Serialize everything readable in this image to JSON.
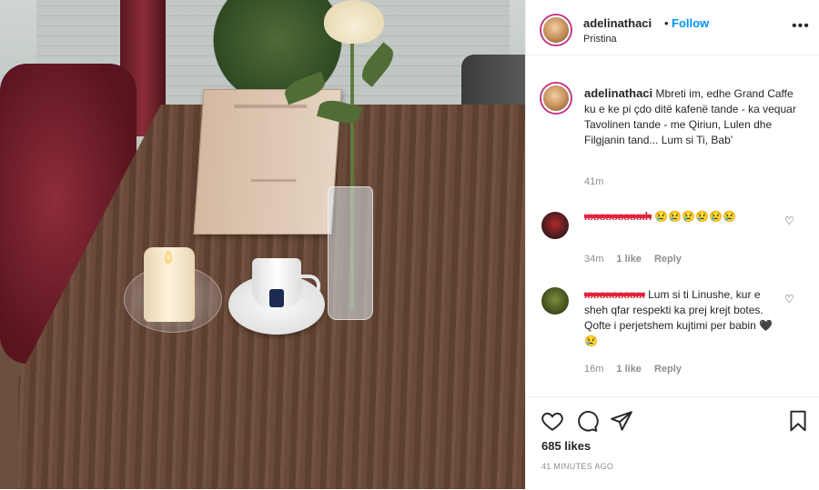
{
  "post": {
    "username": "adelinathaci",
    "follow_label": "Follow",
    "separator": "•",
    "location": "Pristina",
    "more_icon": "more-horizontal-icon"
  },
  "caption": {
    "username": "adelinathaci",
    "text": "Mbreti im, edhe Grand Caffe ku e ke pi çdo ditë kafenë tande - ka vequar Tavolinen tande - me Qiriun, Lulen dhe Filgjanin tand... Lum si Ti, Bab’",
    "time": "41m"
  },
  "comments": [
    {
      "username": "redacted",
      "text": "",
      "emoji": "😢😢😢😢😢😢",
      "time": "34m",
      "likes": "1 like",
      "reply": "Reply"
    },
    {
      "username": "redacted",
      "text": "Lum si ti Linushe, kur e sheh qfar respekti ka prej krejt botes. Qofte i perjetshem kujtimi per babin",
      "emoji": "🖤😢",
      "time": "16m",
      "likes": "1 like",
      "reply": "Reply"
    }
  ],
  "actions": {
    "likes": "685 likes",
    "posted": "41 minutes ago",
    "icons": [
      "heart-icon",
      "comment-icon",
      "share-icon",
      "bookmark-icon"
    ]
  },
  "colors": {
    "link": "#0095f6",
    "muted": "#8e8e8e",
    "text": "#262626"
  }
}
